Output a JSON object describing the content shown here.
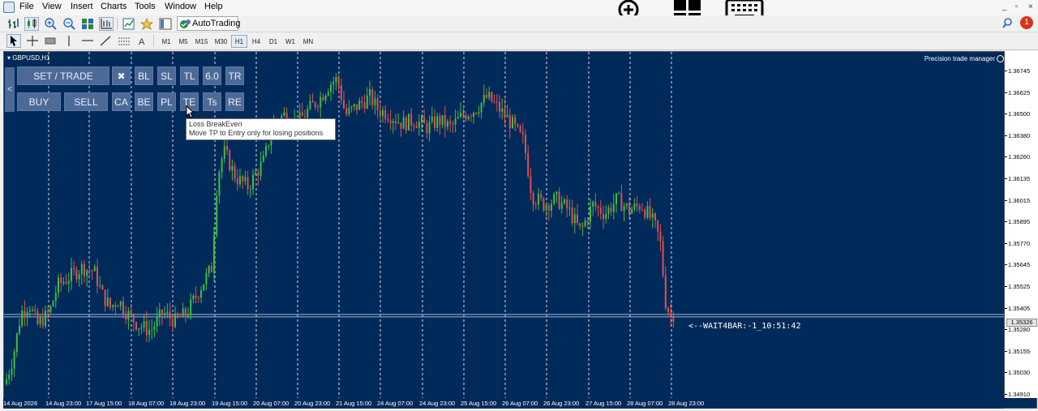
{
  "menubar": {
    "items": [
      "File",
      "View",
      "Insert",
      "Charts",
      "Tools",
      "Window",
      "Help"
    ],
    "overlay_icons": [
      "zoom-in-icon",
      "windows-logo-icon",
      "keyboard-icon"
    ],
    "window_controls": [
      "_",
      "▫",
      "×"
    ],
    "notification_count": "1"
  },
  "toolbar": {
    "autotrading_label": "AutoTrading",
    "timeframes": [
      "M1",
      "M5",
      "M15",
      "M30",
      "H1",
      "H4",
      "D1",
      "W1",
      "MN"
    ],
    "active_timeframe": "H1"
  },
  "chart": {
    "symbol": "GBPUSD,H1",
    "indicator_label": "Precision  trade manager",
    "status_text": "<--WAIT4BAR:-1_10:51:42",
    "colors": {
      "background": "#002a5a",
      "up": "#3fbf3f",
      "down": "#e05050",
      "grid": "#ffffff"
    }
  },
  "panel": {
    "collapse": "<",
    "row1": [
      "SET / TRADE",
      "✖",
      "BL",
      "SL",
      "TL",
      "6.0",
      "TR"
    ],
    "row2": [
      "BUY",
      "SELL",
      "CA",
      "BE",
      "PL",
      "TE",
      "Ts",
      "RE"
    ]
  },
  "tooltip": {
    "title": "Loss BreakEven",
    "text": "Move TP to Entry only for losing positions"
  },
  "price_axis": {
    "ticks": [
      "1.36745",
      "1.36625",
      "1.36500",
      "1.36380",
      "1.36260",
      "1.36135",
      "1.36015",
      "1.35895",
      "1.35770",
      "1.35645",
      "1.35525",
      "1.35405",
      "1.35280",
      "1.35155",
      "1.35030",
      "1.34910"
    ],
    "current_price": "1.35326"
  },
  "time_axis": {
    "labels": [
      "14 Aug 2026",
      "14 Aug 23:00",
      "17 Aug 15:00",
      "18 Aug 07:00",
      "18 Aug 23:00",
      "19 Aug 15:00",
      "20 Aug 07:00",
      "20 Aug 23:00",
      "21 Aug 15:00",
      "24 Aug 07:00",
      "24 Aug 23:00",
      "25 Aug 15:00",
      "26 Aug 07:00",
      "26 Aug 23:00",
      "27 Aug 15:00",
      "28 Aug 07:00",
      "28 Aug 23:00"
    ]
  },
  "chart_data": {
    "type": "candlestick",
    "symbol": "GBPUSD",
    "timeframe": "H1",
    "ylim": [
      1.3487,
      1.368
    ],
    "current_price": 1.35326,
    "close_path": [
      [
        0,
        1.3495
      ],
      [
        10,
        1.351
      ],
      [
        20,
        1.3535
      ],
      [
        30,
        1.354
      ],
      [
        40,
        1.3528
      ],
      [
        55,
        1.3535
      ],
      [
        65,
        1.355
      ],
      [
        80,
        1.3555
      ],
      [
        95,
        1.356
      ],
      [
        110,
        1.3558
      ],
      [
        120,
        1.3545
      ],
      [
        130,
        1.3538
      ],
      [
        140,
        1.3542
      ],
      [
        150,
        1.3535
      ],
      [
        165,
        1.3528
      ],
      [
        180,
        1.3525
      ],
      [
        195,
        1.3535
      ],
      [
        210,
        1.353
      ],
      [
        225,
        1.3535
      ],
      [
        240,
        1.3548
      ],
      [
        255,
        1.356
      ],
      [
        262,
        1.361
      ],
      [
        270,
        1.3625
      ],
      [
        285,
        1.361
      ],
      [
        300,
        1.3605
      ],
      [
        320,
        1.362
      ],
      [
        330,
        1.364
      ],
      [
        345,
        1.3645
      ],
      [
        360,
        1.364
      ],
      [
        375,
        1.3648
      ],
      [
        390,
        1.3655
      ],
      [
        400,
        1.3662
      ],
      [
        410,
        1.3665
      ],
      [
        420,
        1.3645
      ],
      [
        435,
        1.365
      ],
      [
        450,
        1.3655
      ],
      [
        460,
        1.3648
      ],
      [
        475,
        1.3645
      ],
      [
        490,
        1.364
      ],
      [
        505,
        1.3642
      ],
      [
        520,
        1.3638
      ],
      [
        535,
        1.3642
      ],
      [
        550,
        1.3638
      ],
      [
        565,
        1.3645
      ],
      [
        580,
        1.3648
      ],
      [
        595,
        1.3655
      ],
      [
        610,
        1.3648
      ],
      [
        625,
        1.364
      ],
      [
        640,
        1.363
      ],
      [
        650,
        1.36
      ],
      [
        665,
        1.3595
      ],
      [
        680,
        1.3598
      ],
      [
        695,
        1.3592
      ],
      [
        710,
        1.358
      ],
      [
        725,
        1.3595
      ],
      [
        740,
        1.359
      ],
      [
        755,
        1.3598
      ],
      [
        770,
        1.3592
      ],
      [
        785,
        1.3595
      ],
      [
        800,
        1.3585
      ],
      [
        808,
        1.3575
      ],
      [
        815,
        1.354
      ],
      [
        822,
        1.3532
      ],
      [
        826,
        1.3536
      ]
    ]
  }
}
